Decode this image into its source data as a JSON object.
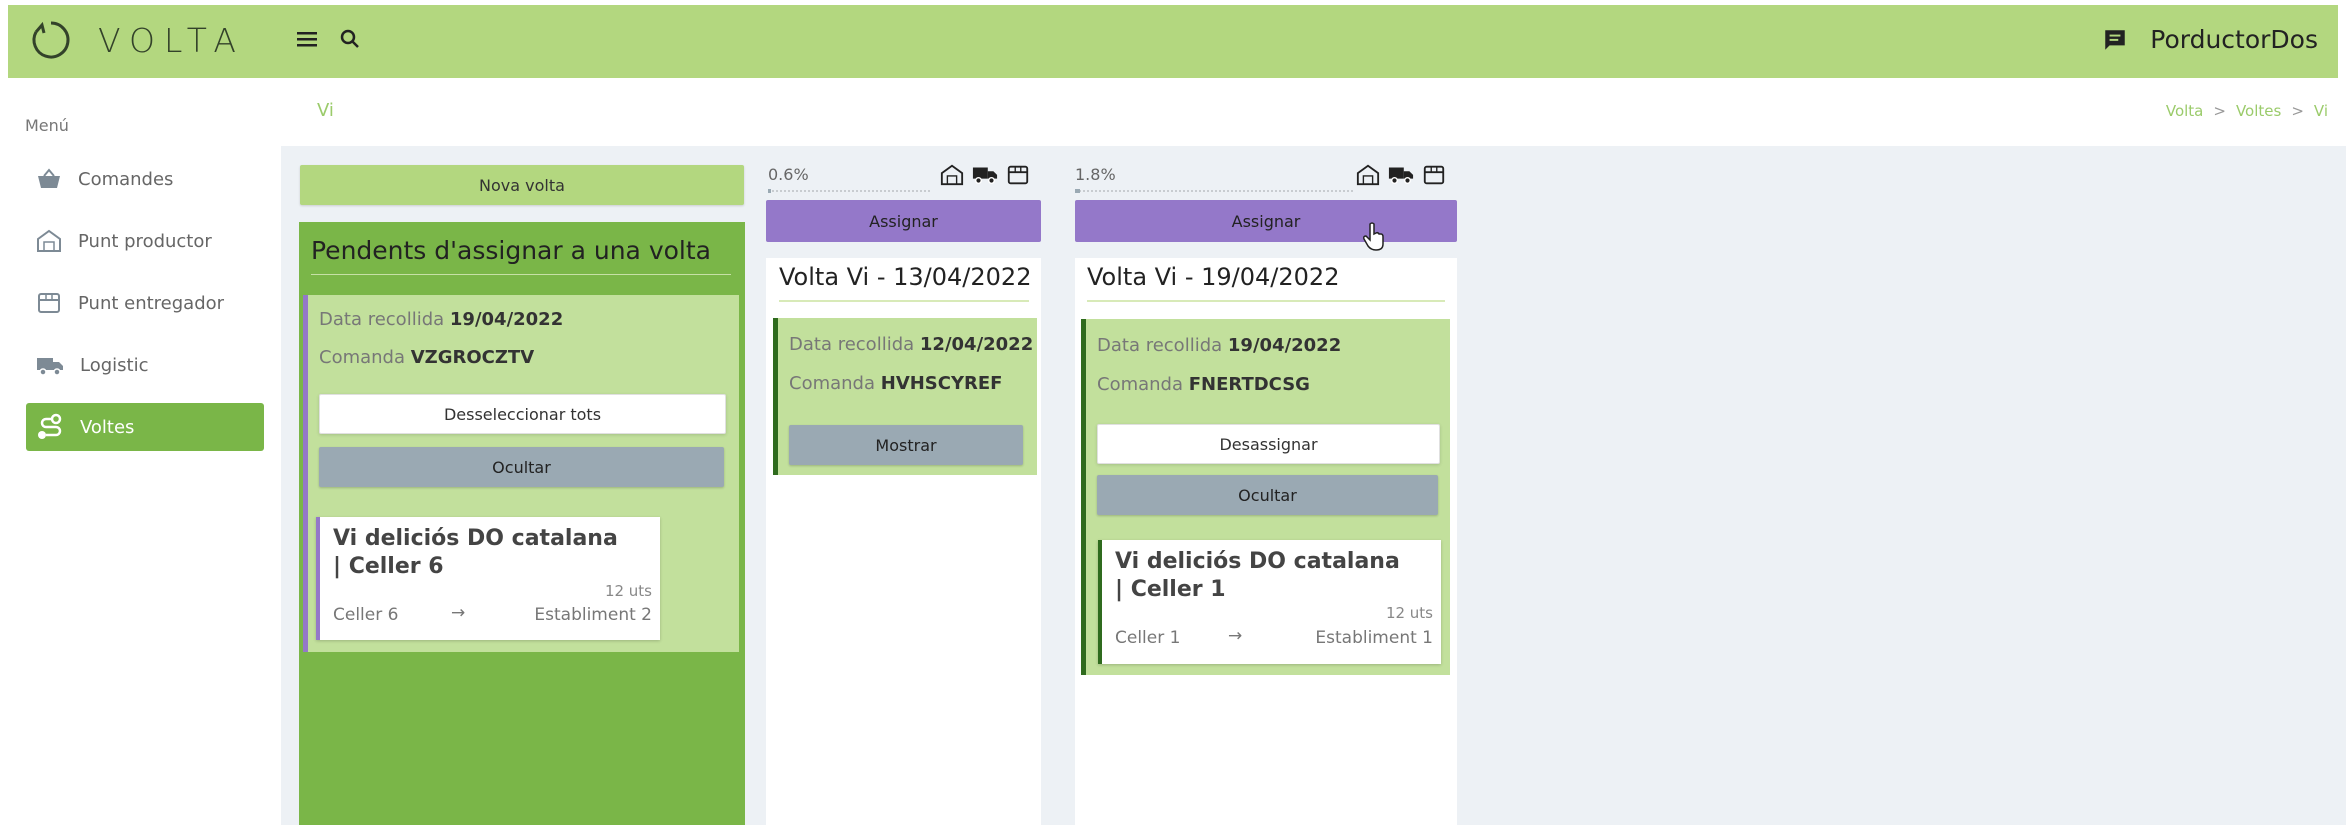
{
  "app": {
    "logo_text": "VOLTA",
    "user": "PorductorDos"
  },
  "sidebar": {
    "title": "Menú",
    "items": [
      {
        "label": "Comandes",
        "icon": "basket-icon"
      },
      {
        "label": "Punt productor",
        "icon": "warehouse-icon"
      },
      {
        "label": "Punt entregador",
        "icon": "store-icon"
      },
      {
        "label": "Logistic",
        "icon": "truck-icon"
      },
      {
        "label": "Voltes",
        "icon": "route-icon",
        "active": true
      }
    ]
  },
  "page": {
    "title": "Vi"
  },
  "breadcrumb": [
    "Volta",
    "Voltes",
    "Vi"
  ],
  "pending": {
    "new_button": "Nova volta",
    "title": "Pendents d'assignar a una volta",
    "order": {
      "date_label": "Data recollida",
      "date": "19/04/2022",
      "order_label": "Comanda",
      "code": "VZGROCZTV",
      "deselect_button": "Desseleccionar tots",
      "hide_button": "Ocultar",
      "product": {
        "name": "Vi deliciós DO catalana | Celler 6",
        "units": "12 uts",
        "from": "Celler 6",
        "arrow": "→",
        "to": "Establiment 2"
      }
    }
  },
  "voltes": [
    {
      "progress_text": "0.6%",
      "progress": 0.006,
      "assign_button": "Assignar",
      "title": "Volta Vi - 13/04/2022",
      "order": {
        "date_label": "Data recollida",
        "date": "12/04/2022",
        "order_label": "Comanda",
        "code": "HVHSCYREF",
        "show_button": "Mostrar"
      }
    },
    {
      "progress_text": "1.8%",
      "progress": 0.018,
      "assign_button": "Assignar",
      "title": "Volta Vi - 19/04/2022",
      "order": {
        "date_label": "Data recollida",
        "date": "19/04/2022",
        "order_label": "Comanda",
        "code": "FNERTDCSG",
        "unassign_button": "Desassignar",
        "hide_button": "Ocultar",
        "product": {
          "name": "Vi deliciós DO catalana | Celler 1",
          "units": "12 uts",
          "from": "Celler 1",
          "arrow": "→",
          "to": "Establiment 1"
        }
      }
    }
  ],
  "colors": {
    "topbar": "#b3d77f",
    "accent_green": "#7ab648",
    "purple": "#9478c9",
    "gray_button": "#9aa9b3"
  }
}
